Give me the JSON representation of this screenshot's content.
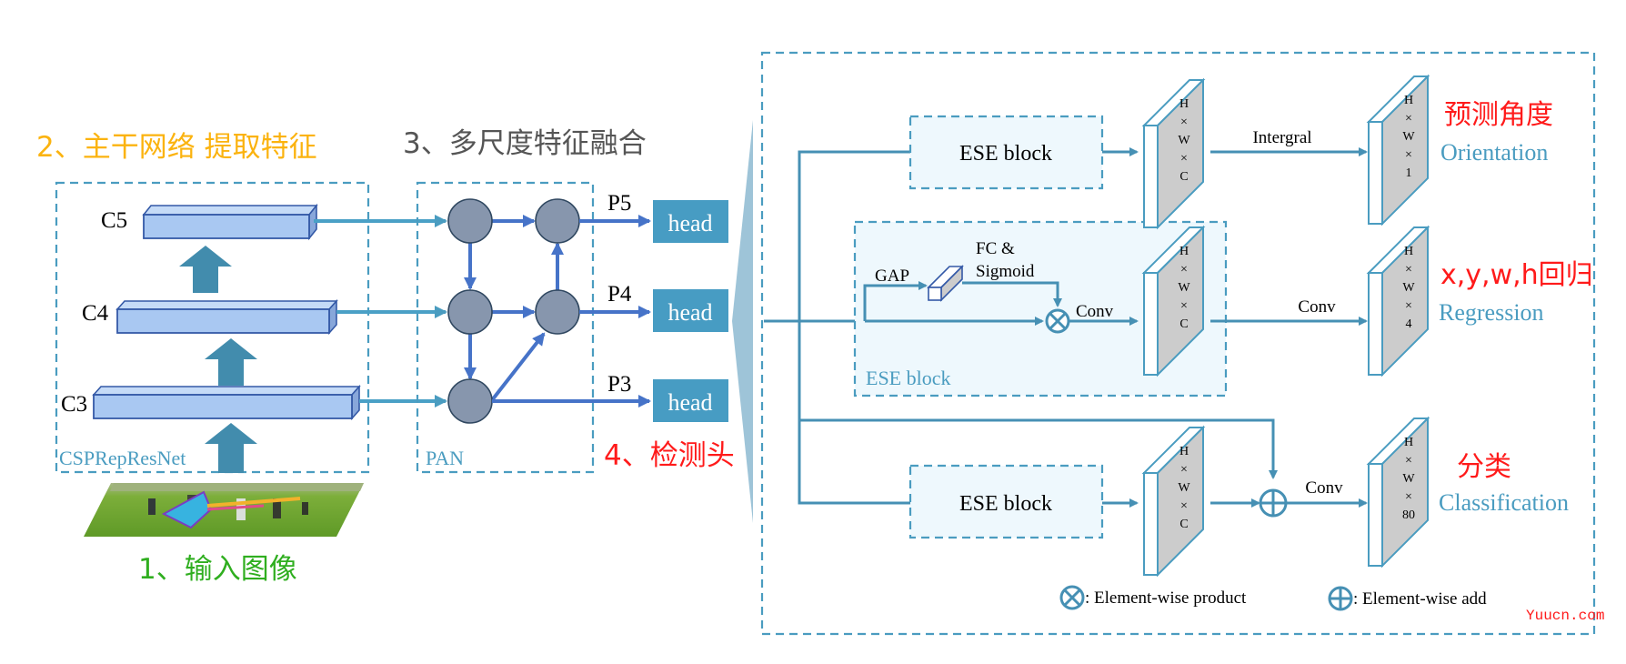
{
  "steps": {
    "input": "1、输入图像",
    "backbone": "2、主干网络 提取特征",
    "neck": "3、多尺度特征融合",
    "head": "4、检测头"
  },
  "colors": {
    "input_label": "#2fae1f",
    "backbone_label": "#fbb30f",
    "neck_label": "#555555",
    "head_label": "#ff1a1a",
    "output_cn": "#ff1a1a",
    "output_en": "#4a9cc0",
    "accent": "#479cc3"
  },
  "backbone": {
    "name": "CSPRepResNet",
    "levels": [
      "C5",
      "C4",
      "C3"
    ]
  },
  "neck": {
    "name": "PAN",
    "outputs": [
      "P5",
      "P4",
      "P3"
    ]
  },
  "heads": [
    "head",
    "head",
    "head"
  ],
  "detail": {
    "ese_block": "ESE block",
    "ese_inner": {
      "gap": "GAP",
      "fc_line1": "FC &",
      "fc_line2": "Sigmoid",
      "conv": "Conv",
      "label": "ESE block"
    },
    "feature_map": [
      "H",
      "×",
      "W",
      "×",
      "C"
    ],
    "branches": [
      {
        "op": "Intergral",
        "dims": [
          "H",
          "×",
          "W",
          "×",
          "1"
        ],
        "label_cn": "预测角度",
        "label_en": "Orientation"
      },
      {
        "op": "Conv",
        "dims": [
          "H",
          "×",
          "W",
          "×",
          "4"
        ],
        "label_cn": "x,y,w,h回归",
        "label_en": "Regression"
      },
      {
        "op": "Conv",
        "dims": [
          "H",
          "×",
          "W",
          "×",
          "80"
        ],
        "label_cn": "分类",
        "label_en": "Classification"
      }
    ],
    "legend": {
      "product": ": Element-wise product",
      "add": ": Element-wise add"
    }
  },
  "watermark": "Yuucn.com"
}
